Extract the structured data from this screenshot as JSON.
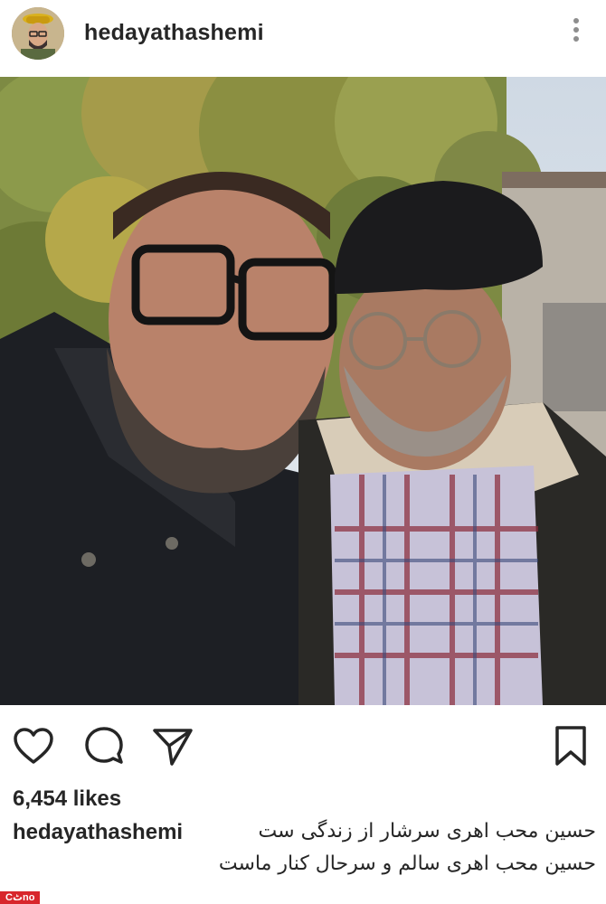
{
  "post": {
    "username": "hedayathashemi",
    "likes": "6,454 likes",
    "caption_user": "hedayathashemi",
    "caption_lines": [
      "حسین محب اهری سرشار از زندگی ست",
      "حسین محب اهری سالم و سرحال کنار ماست"
    ]
  },
  "icons": {
    "avatar": "avatar",
    "more": "more-vertical-icon",
    "like": "heart-icon",
    "comment": "comment-icon",
    "share": "send-icon",
    "save": "bookmark-icon"
  },
  "watermark": "Cٹno",
  "colors": {
    "text": "#262626",
    "muted": "#8e8e8e",
    "watermark_bg": "#d8262c"
  }
}
